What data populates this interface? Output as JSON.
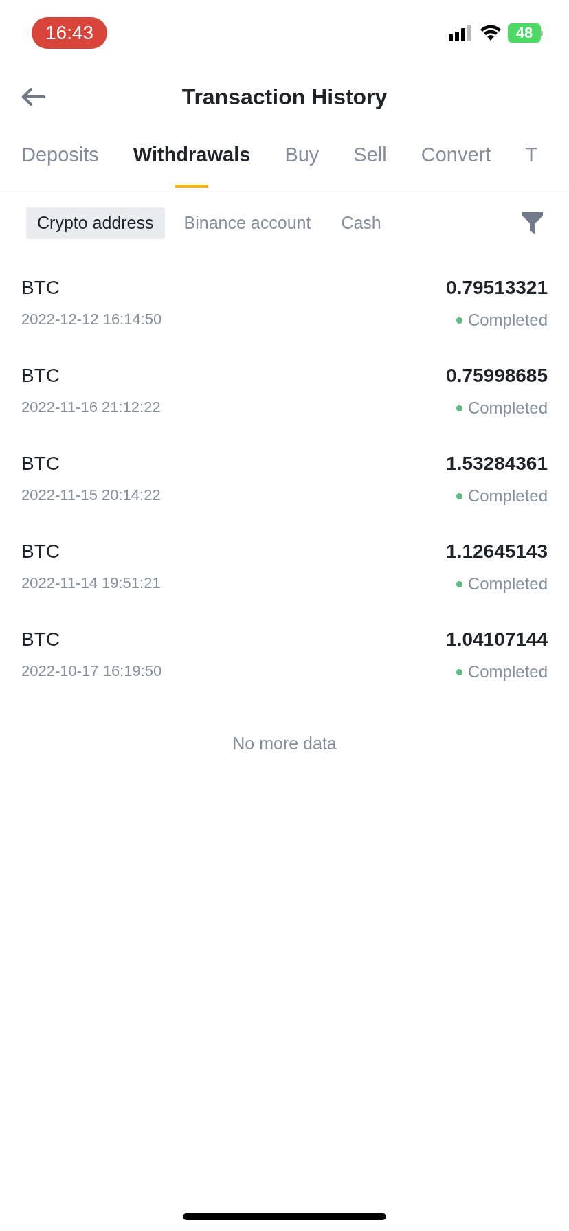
{
  "status_bar": {
    "time": "16:43",
    "battery": "48"
  },
  "header": {
    "title": "Transaction History"
  },
  "tabs": [
    {
      "label": "Deposits",
      "selected": false
    },
    {
      "label": "Withdrawals",
      "selected": true
    },
    {
      "label": "Buy",
      "selected": false
    },
    {
      "label": "Sell",
      "selected": false
    },
    {
      "label": "Convert",
      "selected": false
    },
    {
      "label": "T",
      "selected": false
    }
  ],
  "filters": [
    {
      "label": "Crypto address",
      "selected": true
    },
    {
      "label": "Binance account",
      "selected": false
    },
    {
      "label": "Cash",
      "selected": false
    }
  ],
  "transactions": [
    {
      "coin": "BTC",
      "time": "2022-12-12 16:14:50",
      "amount": "0.79513321",
      "status": "Completed",
      "color": "#58bd7d"
    },
    {
      "coin": "BTC",
      "time": "2022-11-16 21:12:22",
      "amount": "0.75998685",
      "status": "Completed",
      "color": "#58bd7d"
    },
    {
      "coin": "BTC",
      "time": "2022-11-15 20:14:22",
      "amount": "1.53284361",
      "status": "Completed",
      "color": "#58bd7d"
    },
    {
      "coin": "BTC",
      "time": "2022-11-14 19:51:21",
      "amount": "1.12645143",
      "status": "Completed",
      "color": "#58bd7d"
    },
    {
      "coin": "BTC",
      "time": "2022-10-17 16:19:50",
      "amount": "1.04107144",
      "status": "Completed",
      "color": "#58bd7d"
    }
  ],
  "footer_note": "No more data"
}
